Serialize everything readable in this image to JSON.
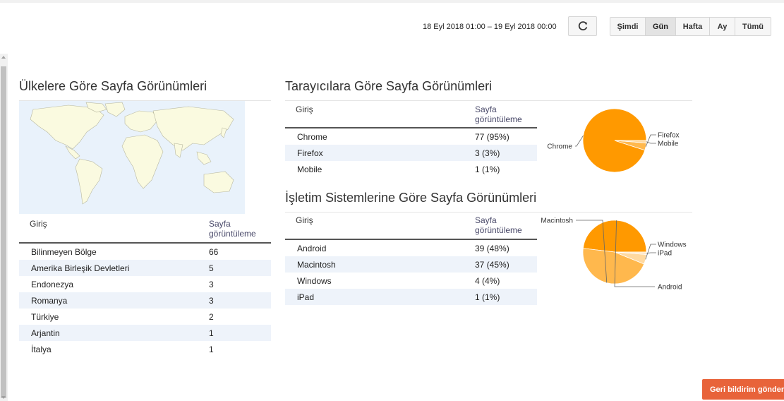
{
  "header": {
    "date_range": "18 Eyl 2018 01:00 – 19 Eyl 2018 00:00",
    "refresh_icon": "refresh-icon",
    "range_buttons": [
      {
        "label": "Şimdi"
      },
      {
        "label": "Gün",
        "active": true
      },
      {
        "label": "Hafta"
      },
      {
        "label": "Ay"
      },
      {
        "label": "Tümü"
      }
    ]
  },
  "countries": {
    "title": "Ülkelere Göre Sayfa Görünümleri",
    "col_entry": "Giriş",
    "col_views": "Sayfa görüntüleme",
    "rows": [
      {
        "name": "Bilinmeyen Bölge",
        "views": "66"
      },
      {
        "name": "Amerika Birleşik Devletleri",
        "views": "5"
      },
      {
        "name": "Endonezya",
        "views": "3"
      },
      {
        "name": "Romanya",
        "views": "3"
      },
      {
        "name": "Türkiye",
        "views": "2"
      },
      {
        "name": "Arjantin",
        "views": "1"
      },
      {
        "name": "İtalya",
        "views": "1"
      }
    ]
  },
  "browsers": {
    "title": "Tarayıcılara Göre Sayfa Görünümleri",
    "col_entry": "Giriş",
    "col_views": "Sayfa görüntüleme",
    "rows": [
      {
        "name": "Chrome",
        "views": "77 (95%)"
      },
      {
        "name": "Firefox",
        "views": "3 (3%)"
      },
      {
        "name": "Mobile",
        "views": "1 (1%)"
      }
    ],
    "chart_data": {
      "type": "pie",
      "categories": [
        "Chrome",
        "Firefox",
        "Mobile"
      ],
      "values": [
        77,
        3,
        1
      ],
      "colors": [
        "#ff9900",
        "#ffb84d",
        "#ffd9a0"
      ]
    }
  },
  "os": {
    "title": "İşletim Sistemlerine Göre Sayfa Görünümleri",
    "col_entry": "Giriş",
    "col_views": "Sayfa görüntüleme",
    "rows": [
      {
        "name": "Android",
        "views": "39 (48%)"
      },
      {
        "name": "Macintosh",
        "views": "37 (45%)"
      },
      {
        "name": "Windows",
        "views": "4 (4%)"
      },
      {
        "name": "iPad",
        "views": "1 (1%)"
      }
    ],
    "chart_data": {
      "type": "pie",
      "categories": [
        "Android",
        "Macintosh",
        "Windows",
        "iPad"
      ],
      "values": [
        39,
        37,
        4,
        1
      ],
      "colors": [
        "#ff9900",
        "#ffb84d",
        "#ffd9a0",
        "#ffe6c4"
      ]
    }
  },
  "feedback": {
    "label": "Geri bildirim gönder"
  },
  "colors": {
    "accent": "#ff9900",
    "feedback": "#e8633a",
    "alt_row": "#eef3fa"
  }
}
